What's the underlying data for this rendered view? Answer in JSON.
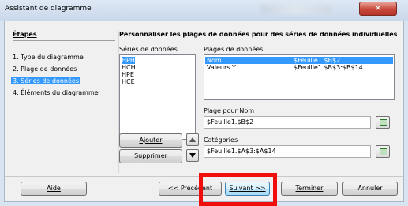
{
  "window": {
    "title": "Assistant de diagramme",
    "close_glyph": "✕"
  },
  "steps": {
    "title": "Étapes",
    "items": [
      {
        "label": "1. Type du diagramme",
        "selected": false
      },
      {
        "label": "2. Plage de données",
        "selected": false
      },
      {
        "label": "3. Séries de données",
        "selected": true
      },
      {
        "label": "4. Éléments du diagramme",
        "selected": false
      }
    ]
  },
  "main": {
    "title": "Personnaliser les plages de données pour des séries de données individuelles",
    "series_label": "Séries de données",
    "series": [
      "HPH",
      "HCH",
      "HPE",
      "HCE"
    ],
    "selected_series": "HPH",
    "ranges_label": "Plages de données",
    "ranges": [
      {
        "name": "Nom",
        "value": "$Feuille1.$B$2",
        "selected": true
      },
      {
        "name": "Valeurs Y",
        "value": "$Feuille1.$B$3:$B$14",
        "selected": false
      }
    ],
    "range_for_name_label": "Plage pour Nom",
    "range_for_name_value": "$Feuille1.$B$2",
    "categories_label": "Catégories",
    "categories_value": "$Feuille1.$A$3:$A$14",
    "add_label": "Ajouter",
    "remove_label": "Supprimer"
  },
  "footer": {
    "help_label": "Aide",
    "prev_label": "<< Précédent",
    "next_label": "Suivant >>",
    "finish_label": "Terminer",
    "cancel_label": "Annuler"
  },
  "colors": {
    "selection": "#3399ff",
    "highlight_box": "#f20d0d",
    "titlebar": "#c9d8eb"
  }
}
